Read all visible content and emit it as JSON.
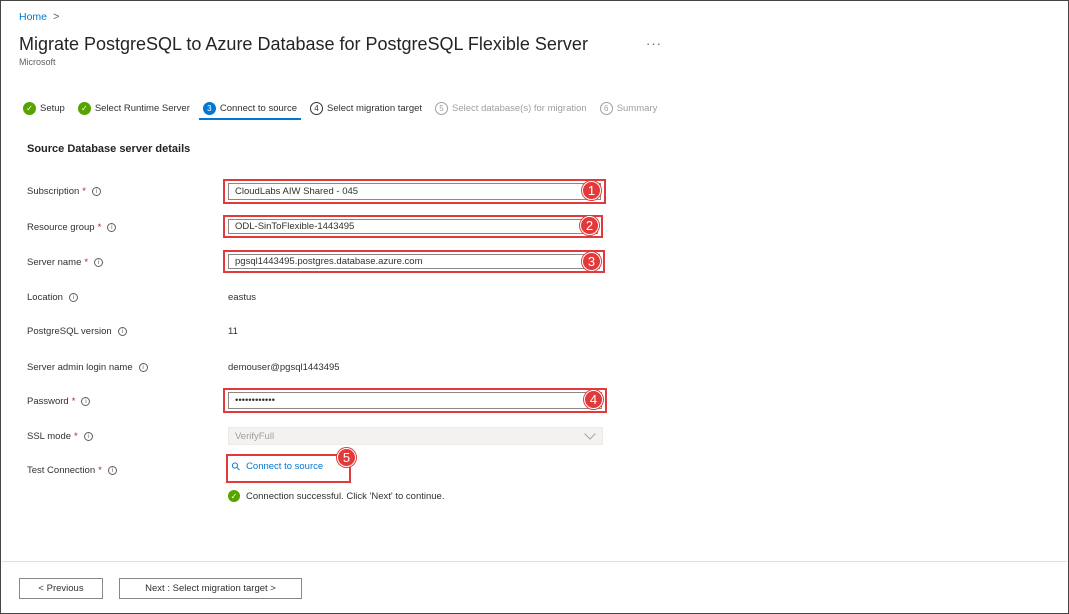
{
  "breadcrumb": {
    "home": "Home",
    "chevron": ">"
  },
  "header": {
    "title": "Migrate PostgreSQL to Azure Database for PostgreSQL Flexible Server",
    "more": "···",
    "publisher": "Microsoft"
  },
  "tabs": [
    {
      "label": "Setup",
      "marker": "✓",
      "state": "done"
    },
    {
      "label": "Select Runtime Server",
      "marker": "✓",
      "state": "done"
    },
    {
      "label": "Connect to source",
      "marker": "3",
      "state": "active"
    },
    {
      "label": "Select migration target",
      "marker": "4",
      "state": "next"
    },
    {
      "label": "Select database(s) for migration",
      "marker": "5",
      "state": "disabled"
    },
    {
      "label": "Summary",
      "marker": "6",
      "state": "disabled"
    }
  ],
  "section": {
    "title": "Source Database server details"
  },
  "form": {
    "required_mark": "*",
    "info_glyph": "i",
    "subscription": {
      "label": "Subscription",
      "value": "CloudLabs AIW Shared - 045",
      "badge": "1"
    },
    "resource_group": {
      "label": "Resource group",
      "value": "ODL-SinToFlexible-1443495",
      "badge": "2"
    },
    "server_name": {
      "label": "Server name",
      "value": "pgsql1443495.postgres.database.azure.com",
      "badge": "3"
    },
    "location": {
      "label": "Location",
      "value": "eastus"
    },
    "pg_version": {
      "label": "PostgreSQL version",
      "value": "11"
    },
    "admin_login": {
      "label": "Server admin login name",
      "value": "demouser@pgsql1443495"
    },
    "password": {
      "label": "Password",
      "value": "••••••••••••",
      "badge": "4"
    },
    "ssl_mode": {
      "label": "SSL mode",
      "value": "VerifyFull"
    },
    "test_connection": {
      "label": "Test Connection",
      "link": "Connect to source",
      "badge": "5"
    },
    "success_message": "Connection successful. Click 'Next' to continue.",
    "success_glyph": "✓"
  },
  "footer": {
    "previous": "< Previous",
    "next": "Next : Select migration target >"
  },
  "colors": {
    "accent": "#0078d4",
    "success": "#57a300",
    "highlight": "#e23a3a",
    "required": "#a4262c"
  }
}
